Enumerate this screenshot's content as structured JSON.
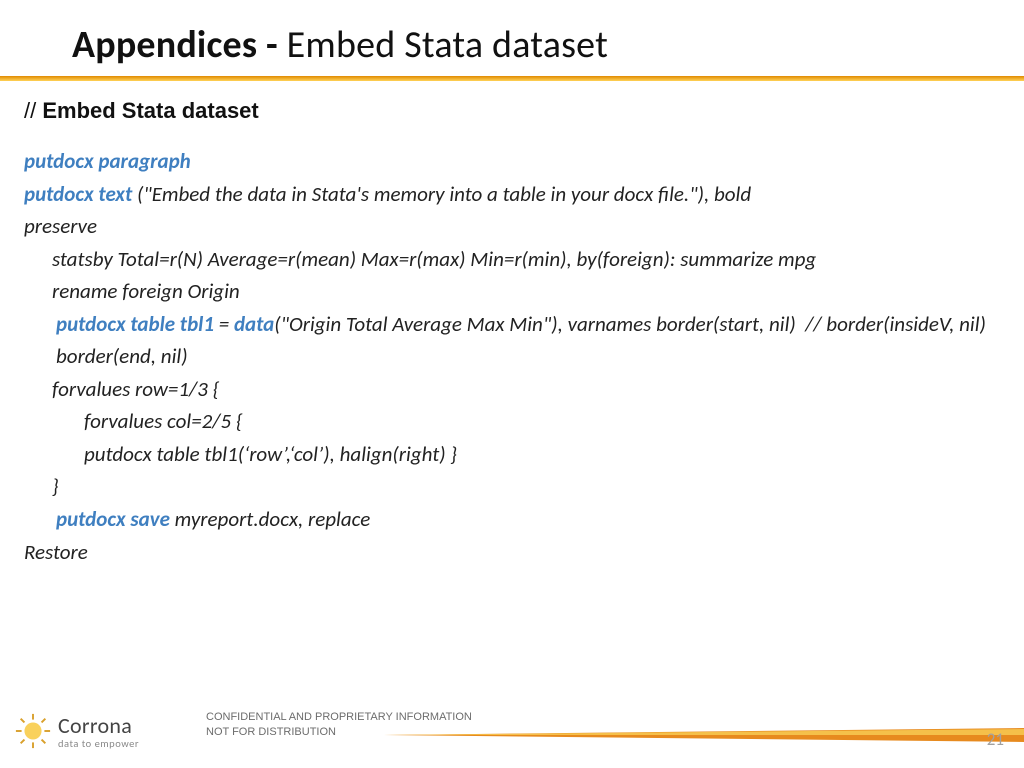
{
  "title": {
    "bold": "Appendices - ",
    "rest": "Embed Stata dataset"
  },
  "subtitle": {
    "prefix": "// ",
    "main": "Embed Stata dataset"
  },
  "code": {
    "l1_kw": "putdocx paragraph",
    "l2_kw": "putdocx text ",
    "l2_rest": "(\"Embed the data in Stata's memory into a table in your docx file.\"), bold",
    "l3": "preserve",
    "l4": "statsby Total=r(N) Average=r(mean) Max=r(max) Min=r(min), by(foreign): summarize mpg",
    "l5": "rename foreign Origin",
    "l6_kw": "putdocx table tbl1 ",
    "l6_mid": "= ",
    "l6_kw2": "data",
    "l6_rest": "(\"Origin Total Average Max Min\"), varnames border(start, nil)  // border(insideV, nil) border(end, nil)",
    "l7": "forvalues row=1/3 {",
    "l8": "forvalues col=2/5 {",
    "l9": "putdocx table tbl1(‘row’,‘col’), halign(right) }",
    "l10": "}",
    "l11_kw": "putdocx save ",
    "l11_rest": "myreport.docx, replace",
    "l12": "Restore"
  },
  "footer": {
    "brand_name": "Corrona",
    "brand_tag": "data to empower",
    "legal1": "CONFIDENTIAL AND PROPRIETARY INFORMATION",
    "legal2": "NOT FOR DISTRIBUTION",
    "page": "21"
  }
}
